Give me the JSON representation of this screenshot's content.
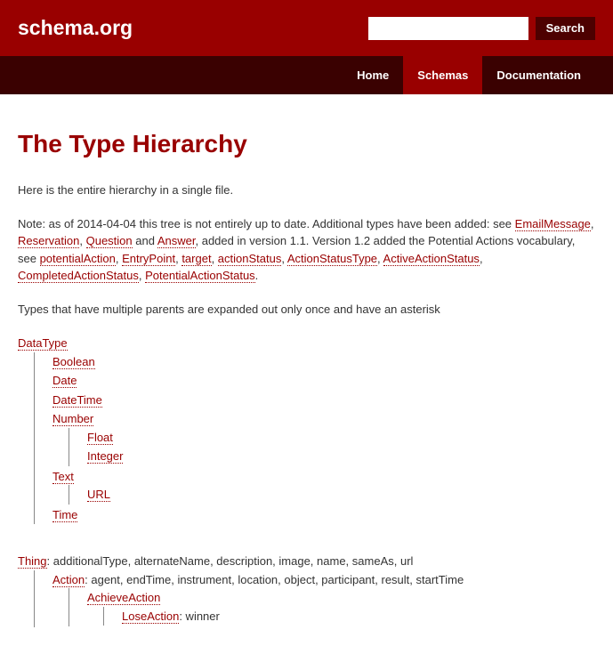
{
  "header": {
    "logo": "schema.org",
    "search_placeholder": "",
    "search_button": "Search"
  },
  "nav": {
    "items": [
      {
        "label": "Home",
        "active": false
      },
      {
        "label": "Schemas",
        "active": true
      },
      {
        "label": "Documentation",
        "active": false
      }
    ]
  },
  "page": {
    "title": "The Type Hierarchy",
    "intro": "Here is the entire hierarchy in a single file.",
    "note_prefix": "Note: as of 2014-04-04 this tree is not entirely up to date. Additional types have been added: see ",
    "note_links1": [
      "EmailMessage",
      "Reservation",
      "Question"
    ],
    "note_and": " and ",
    "note_links1_last": "Answer",
    "note_mid": ", added in version 1.1. Version 1.2 added the Potential Actions vocabulary, see ",
    "note_links2": [
      "potentialAction",
      "EntryPoint",
      "target",
      "actionStatus",
      "ActionStatusType",
      "ActiveActionStatus",
      "CompletedActionStatus",
      "PotentialActionStatus"
    ],
    "note_end": ".",
    "asterisk_note": "Types that have multiple parents are expanded out only once and have an asterisk"
  },
  "tree1": {
    "root": "DataType",
    "children": [
      {
        "name": "Boolean"
      },
      {
        "name": "Date"
      },
      {
        "name": "DateTime"
      },
      {
        "name": "Number",
        "children": [
          {
            "name": "Float"
          },
          {
            "name": "Integer"
          }
        ]
      },
      {
        "name": "Text",
        "children": [
          {
            "name": "URL"
          }
        ]
      },
      {
        "name": "Time"
      }
    ]
  },
  "tree2": {
    "root": "Thing",
    "root_props": ": additionalType, alternateName, description, image, name, sameAs, url",
    "children": [
      {
        "name": "Action",
        "props": ": agent, endTime, instrument, location, object, participant, result, startTime",
        "children": [
          {
            "name": "AchieveAction",
            "children": [
              {
                "name": "LoseAction",
                "props": ": winner"
              }
            ]
          }
        ]
      }
    ]
  }
}
